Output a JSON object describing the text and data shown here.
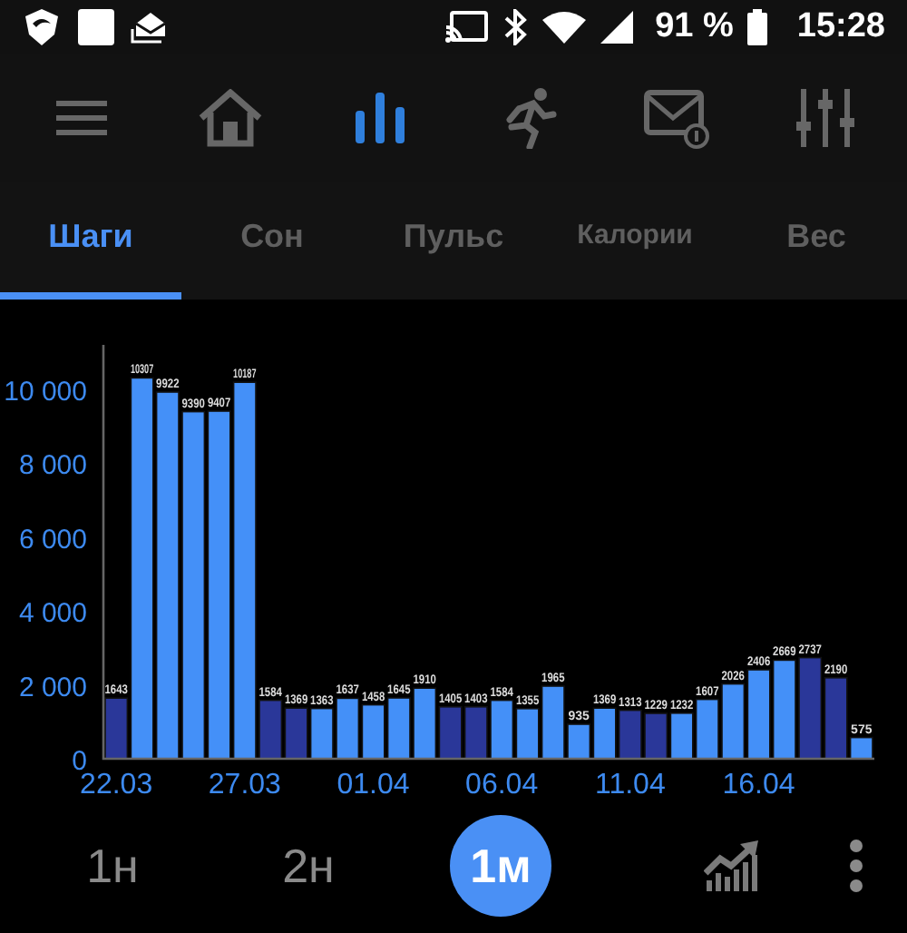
{
  "status_bar": {
    "battery": "91 %",
    "time": "15:28"
  },
  "toolbar": [
    {
      "kind": "menu",
      "selected": false
    },
    {
      "kind": "home",
      "selected": false
    },
    {
      "kind": "stats",
      "selected": true
    },
    {
      "kind": "activity",
      "selected": false
    },
    {
      "kind": "messages",
      "selected": false
    },
    {
      "kind": "settings",
      "selected": false
    }
  ],
  "tabs": [
    {
      "label": "Шаги",
      "selected": true
    },
    {
      "label": "Сон",
      "selected": false
    },
    {
      "label": "Пульс",
      "selected": false
    },
    {
      "label": "Калории",
      "selected": false
    },
    {
      "label": "Вес",
      "selected": false
    }
  ],
  "chart": {
    "chart_data": {
      "type": "bar",
      "data_labels": true,
      "categories": [
        "22.03",
        null,
        null,
        null,
        null,
        "27.03",
        null,
        null,
        null,
        null,
        "01.04",
        null,
        null,
        null,
        null,
        "06.04",
        null,
        null,
        null,
        null,
        "11.04",
        null,
        null,
        null,
        null,
        "16.04",
        null,
        null,
        null,
        null
      ],
      "ylim": [
        0,
        11200
      ],
      "yticks": [
        {
          "value": 0,
          "label": "0"
        },
        {
          "value": 2000,
          "label": "2 000"
        },
        {
          "value": 4000,
          "label": "4 000"
        },
        {
          "value": 6000,
          "label": "6 000"
        },
        {
          "value": 8000,
          "label": "8 000"
        },
        {
          "value": 10000,
          "label": "10 000"
        }
      ],
      "series": [
        {
          "color": "#4490f8",
          "values": [
            null,
            10307,
            9922,
            9390,
            9407,
            10187,
            null,
            null,
            1363,
            1637,
            1458,
            1645,
            1910,
            null,
            null,
            1584,
            1355,
            1965,
            935,
            1369,
            null,
            null,
            1232,
            1607,
            2026,
            2406,
            2669,
            null,
            null,
            575
          ]
        },
        {
          "color": "#2a3799",
          "values": [
            1643,
            null,
            null,
            null,
            null,
            null,
            1584,
            1369,
            null,
            null,
            null,
            null,
            null,
            1405,
            1403,
            null,
            null,
            null,
            null,
            null,
            1313,
            1229,
            null,
            null,
            null,
            null,
            null,
            2737,
            2190,
            null
          ]
        }
      ]
    }
  },
  "periods": [
    {
      "label": "1н",
      "selected": false
    },
    {
      "label": "2н",
      "selected": false
    },
    {
      "label": "1м",
      "selected": true
    }
  ]
}
